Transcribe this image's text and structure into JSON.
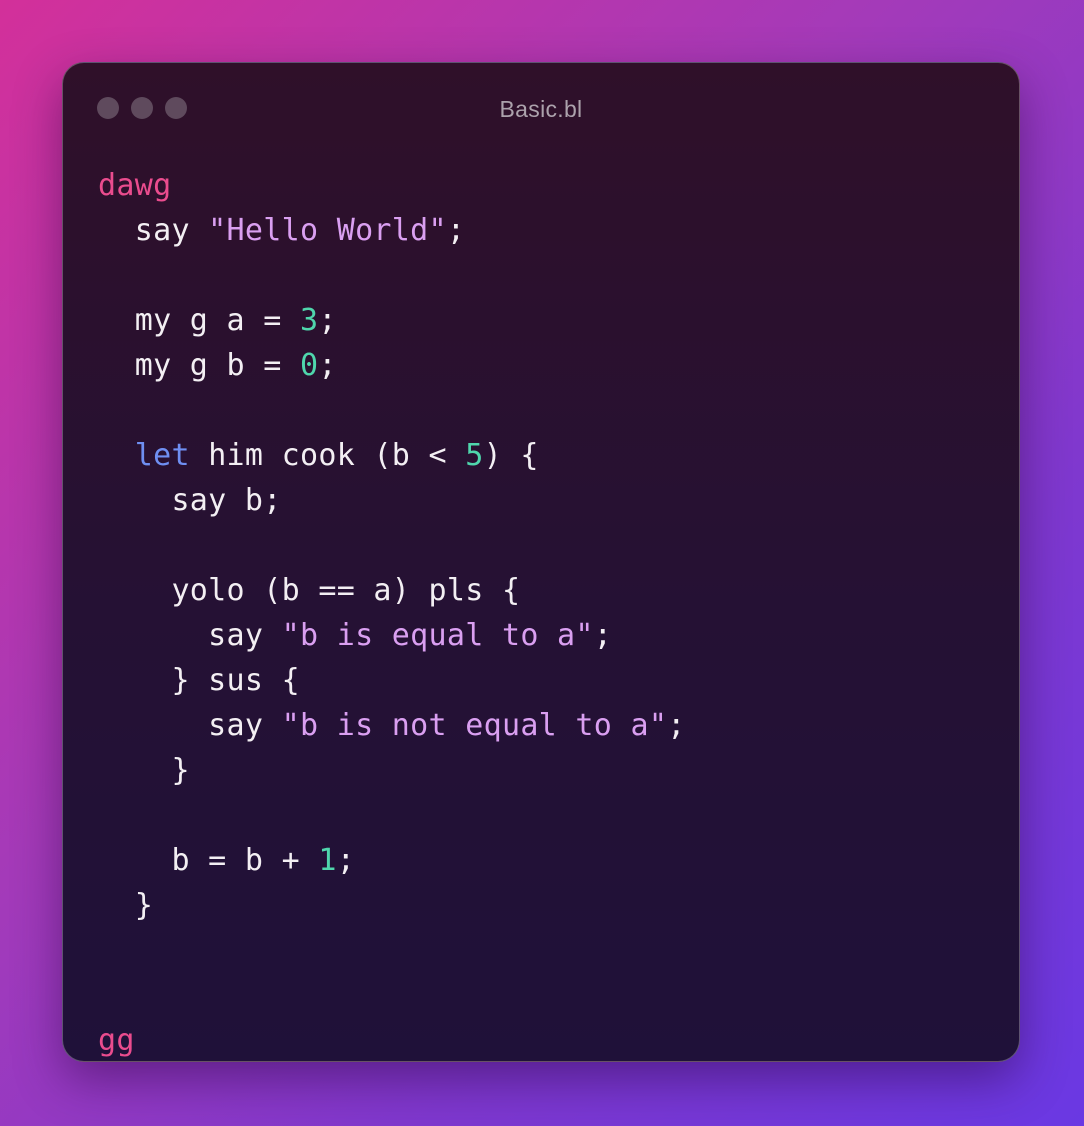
{
  "window": {
    "title": "Basic.bl",
    "buttons": [
      "close",
      "minimize",
      "maximize"
    ]
  },
  "colors": {
    "program_keyword": "#ea4c8e",
    "control_keyword": "#6f8ff2",
    "string": "#da9ff1",
    "number": "#4fd6ac",
    "default_text": "#f3eff3"
  },
  "code": {
    "lines": [
      [
        {
          "t": "dawg",
          "c": "kw-pink"
        }
      ],
      [
        {
          "t": "  say "
        },
        {
          "t": "\"Hello World\"",
          "c": "str"
        },
        {
          "t": ";"
        }
      ],
      [],
      [
        {
          "t": "  my g a = "
        },
        {
          "t": "3",
          "c": "num"
        },
        {
          "t": ";"
        }
      ],
      [
        {
          "t": "  my g b = "
        },
        {
          "t": "0",
          "c": "num"
        },
        {
          "t": ";"
        }
      ],
      [],
      [
        {
          "t": "  "
        },
        {
          "t": "let",
          "c": "kw-blue"
        },
        {
          "t": " him cook (b < "
        },
        {
          "t": "5",
          "c": "num"
        },
        {
          "t": ") {"
        }
      ],
      [
        {
          "t": "    say b;"
        }
      ],
      [],
      [
        {
          "t": "    yolo (b == a) pls {"
        }
      ],
      [
        {
          "t": "      say "
        },
        {
          "t": "\"b is equal to a\"",
          "c": "str"
        },
        {
          "t": ";"
        }
      ],
      [
        {
          "t": "    } sus {"
        }
      ],
      [
        {
          "t": "      say "
        },
        {
          "t": "\"b is not equal to a\"",
          "c": "str"
        },
        {
          "t": ";"
        }
      ],
      [
        {
          "t": "    }"
        }
      ],
      [],
      [
        {
          "t": "    b = b + "
        },
        {
          "t": "1",
          "c": "num"
        },
        {
          "t": ";"
        }
      ],
      [
        {
          "t": "  }"
        }
      ],
      [],
      [],
      [
        {
          "t": "gg",
          "c": "kw-pink"
        }
      ]
    ]
  }
}
